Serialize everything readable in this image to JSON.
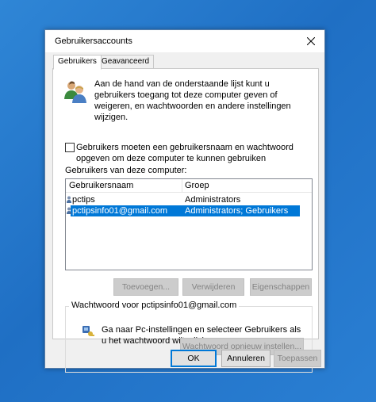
{
  "window": {
    "title": "Gebruikersaccounts",
    "close_symbol": "✕"
  },
  "tabs": [
    {
      "label": "Gebruikers",
      "active": true
    },
    {
      "label": "Geavanceerd",
      "active": false
    }
  ],
  "intro": {
    "icon": "users-icon",
    "text": "Aan de hand van de onderstaande lijst kunt u gebruikers toegang tot deze computer geven of weigeren, en wachtwoorden en andere instellingen wijzigen."
  },
  "require_login": {
    "checked": false,
    "label": "Gebruikers moeten een gebruikersnaam en wachtwoord opgeven om deze computer te kunnen gebruiken"
  },
  "users_list": {
    "title": "Gebruikers van deze computer:",
    "columns": [
      "Gebruikersnaam",
      "Groep"
    ],
    "rows": [
      {
        "name": "pctips",
        "group": "Administrators",
        "selected": false
      },
      {
        "name": "pctipsinfo01@gmail.com",
        "group": "Administrators; Gebruikers",
        "selected": true
      }
    ]
  },
  "user_buttons": {
    "add": "Toevoegen...",
    "remove": "Verwijderen",
    "properties": "Eigenschappen"
  },
  "password_group": {
    "title": "Wachtwoord voor pctipsinfo01@gmail.com",
    "icon": "key-icon",
    "text": "Ga naar Pc-instellingen en selecteer Gebruikers als u het wachtwoord wilt wijzigen.",
    "reset_button": "Wachtwoord opnieuw instellen..."
  },
  "footer": {
    "ok": "OK",
    "cancel": "Annuleren",
    "apply": "Toepassen"
  },
  "colors": {
    "selection": "#0078d7",
    "desktop": "#1f6fc4"
  }
}
